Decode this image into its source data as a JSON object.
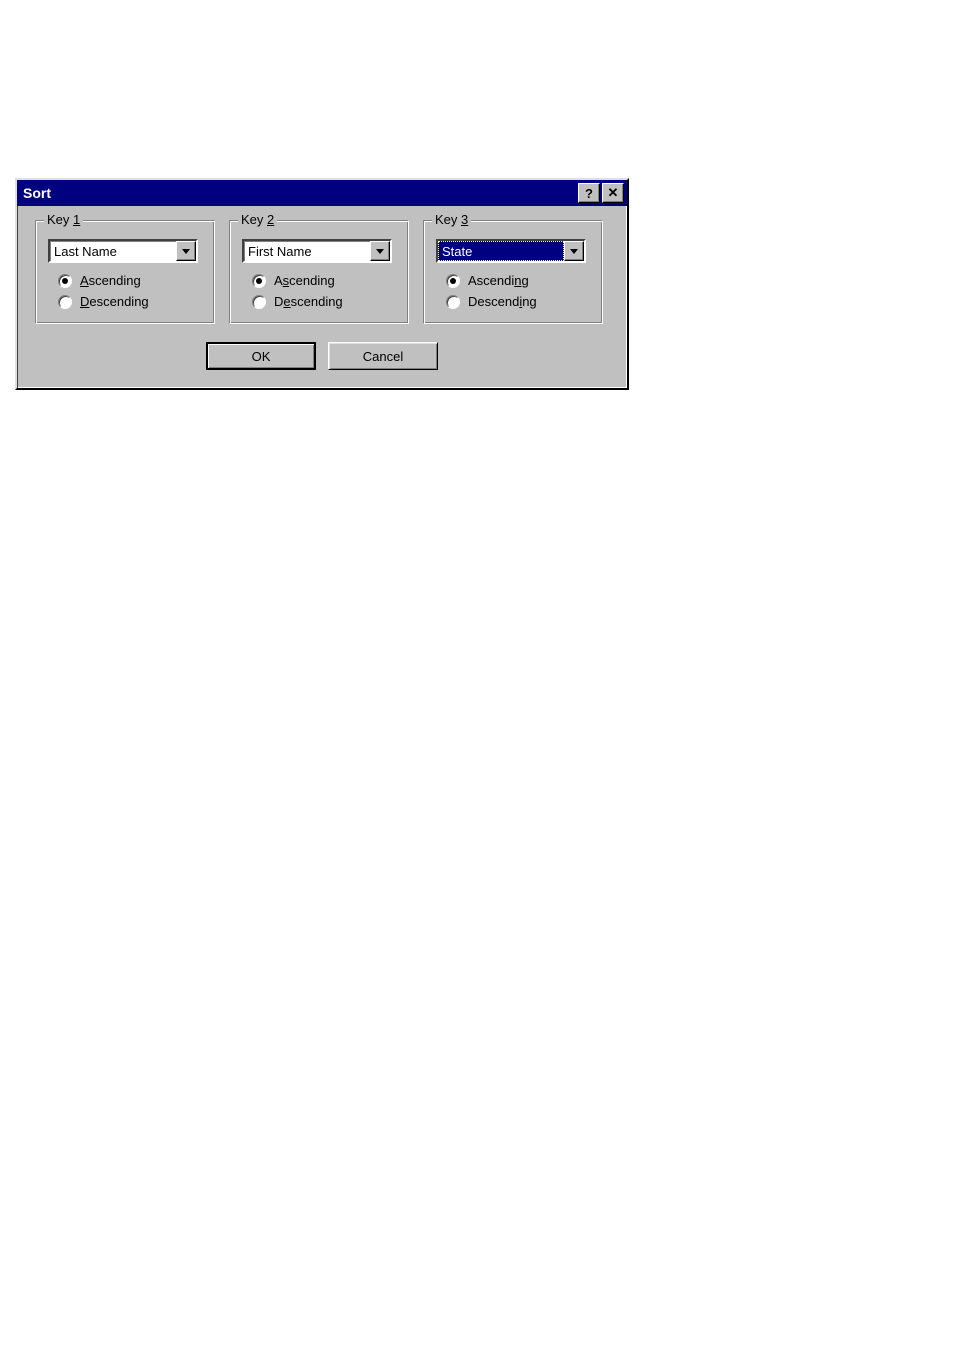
{
  "title": "Sort",
  "keys": [
    {
      "label_pre": "Key ",
      "label_u": "1",
      "label_post": "",
      "combo_value": "Last Name",
      "selected": false,
      "asc_checked": true,
      "asc_pre": "",
      "asc_u": "A",
      "asc_post": "scending",
      "desc_checked": false,
      "desc_pre": "",
      "desc_u": "D",
      "desc_post": "escending"
    },
    {
      "label_pre": "Key ",
      "label_u": "2",
      "label_post": "",
      "combo_value": "First Name",
      "selected": false,
      "asc_checked": true,
      "asc_pre": "A",
      "asc_u": "s",
      "asc_post": "cending",
      "desc_checked": false,
      "desc_pre": "D",
      "desc_u": "e",
      "desc_post": "scending"
    },
    {
      "label_pre": "Key ",
      "label_u": "3",
      "label_post": "",
      "combo_value": "State",
      "selected": true,
      "asc_checked": true,
      "asc_pre": "Ascendi",
      "asc_u": "n",
      "asc_post": "g",
      "desc_checked": false,
      "desc_pre": "Descend",
      "desc_u": "i",
      "desc_post": "ng"
    }
  ],
  "buttons": {
    "ok": "OK",
    "cancel": "Cancel"
  }
}
